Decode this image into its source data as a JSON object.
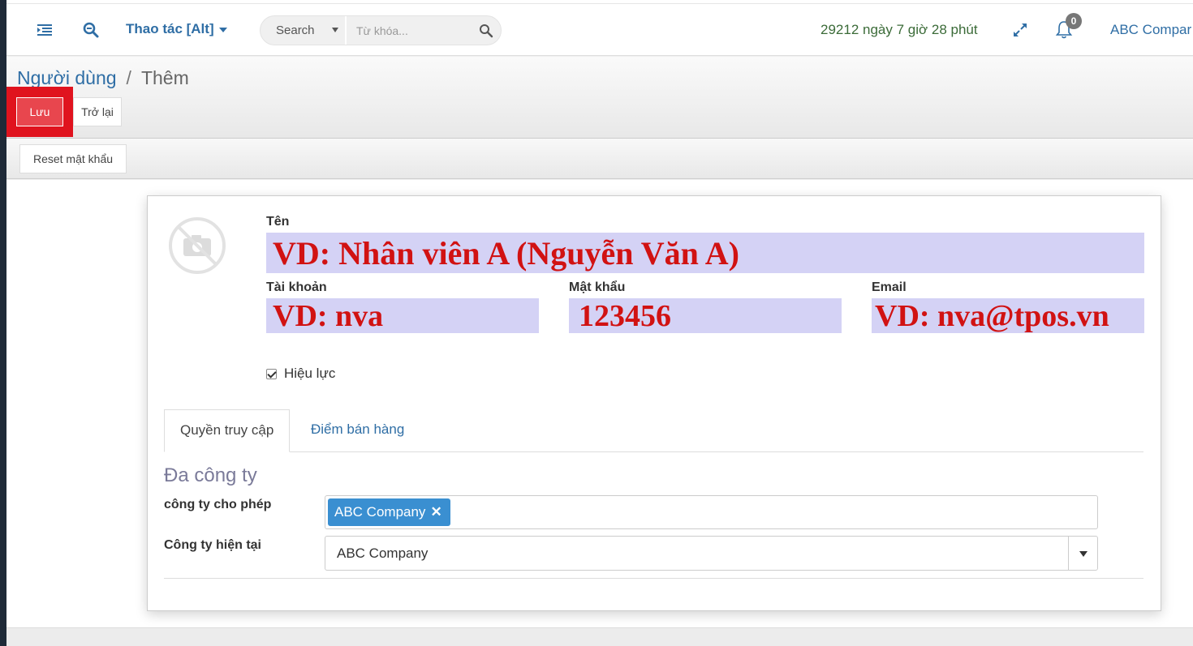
{
  "navbar": {
    "menu_icon": "list-menu-icon",
    "search_icon": "zoom-search-icon",
    "actions_label": "Thao tác [Alt]",
    "search": {
      "select_label": "Search",
      "placeholder": "Từ khóa..."
    },
    "timer_text": "29212 ngày 7 giờ 28 phút",
    "notification_count": "0",
    "company": "ABC Compar"
  },
  "breadcrumb": {
    "parent": "Người dùng",
    "separator": "/",
    "current": "Thêm"
  },
  "toolbar": {
    "save_label": "Lưu",
    "back_label": "Trở lại"
  },
  "statusbar": {
    "reset_password_label": "Reset mật khẩu"
  },
  "form": {
    "name": {
      "label": "Tên",
      "placeholder": "VD: Nhân viên A (Nguyễn Văn A)"
    },
    "login": {
      "label": "Tài khoản",
      "placeholder": "VD: nva"
    },
    "password": {
      "label": "Mật khẩu",
      "value": "123456"
    },
    "email": {
      "label": "Email",
      "placeholder": "VD: nva@tpos.vn"
    },
    "active": {
      "label": "Hiệu lực",
      "checked": true
    },
    "tabs": [
      {
        "label": "Quyền truy cập"
      },
      {
        "label": "Điểm bán hàng"
      }
    ],
    "group_title": "Đa công ty",
    "allowed_companies": {
      "label": "công ty cho phép",
      "tags": [
        "ABC Company"
      ]
    },
    "current_company": {
      "label": "Công ty hiện tại",
      "value": "ABC Company"
    }
  },
  "colors": {
    "accent": "#2f6ea5",
    "highlight": "#d4d2f5",
    "highlight_text": "#d11212",
    "save_button": "#e8464e",
    "tag": "#3a8fd1"
  }
}
